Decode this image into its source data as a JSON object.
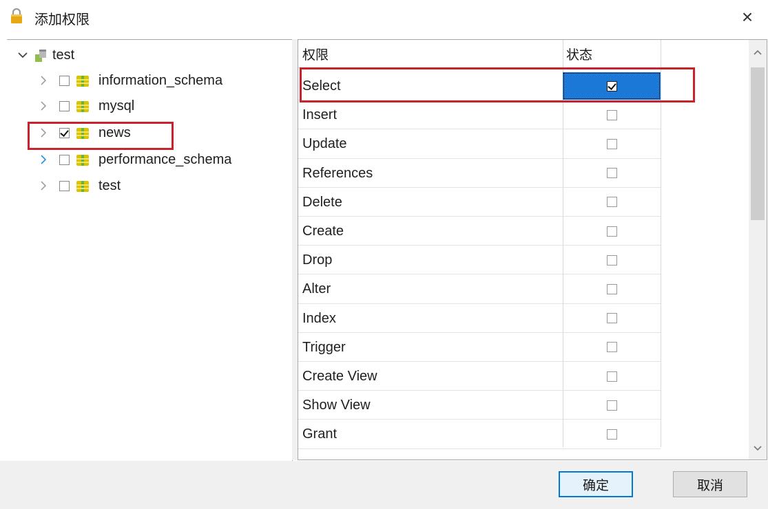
{
  "window": {
    "title": "添加权限",
    "close_glyph": "×"
  },
  "tree": {
    "root": {
      "label": "test",
      "icon": "user-icon",
      "expanded": true
    },
    "items": [
      {
        "label": "information_schema",
        "checked": false,
        "icon": "database-icon"
      },
      {
        "label": "mysql",
        "checked": false,
        "icon": "database-icon"
      },
      {
        "label": "news",
        "checked": true,
        "icon": "database-icon"
      },
      {
        "label": "performance_schema",
        "checked": false,
        "icon": "database-icon"
      },
      {
        "label": "test",
        "checked": false,
        "icon": "database-icon"
      }
    ],
    "chevron_glyph": "›",
    "root_chevron_glyph": "⌄"
  },
  "grid": {
    "headers": {
      "privilege": "权限",
      "state": "状态"
    },
    "rows": [
      {
        "name": "Select",
        "checked": true,
        "selected": true
      },
      {
        "name": "Insert",
        "checked": false
      },
      {
        "name": "Update",
        "checked": false
      },
      {
        "name": "References",
        "checked": false
      },
      {
        "name": "Delete",
        "checked": false
      },
      {
        "name": "Create",
        "checked": false
      },
      {
        "name": "Drop",
        "checked": false
      },
      {
        "name": "Alter",
        "checked": false
      },
      {
        "name": "Index",
        "checked": false
      },
      {
        "name": "Trigger",
        "checked": false
      },
      {
        "name": "Create View",
        "checked": false
      },
      {
        "name": "Show View",
        "checked": false
      },
      {
        "name": "Grant",
        "checked": false
      }
    ]
  },
  "scrollbar": {
    "up_glyph": "⌃",
    "down_glyph": "⌄"
  },
  "buttons": {
    "ok": "确定",
    "cancel": "取消"
  },
  "colors": {
    "highlight_red": "#c8232c",
    "selection_blue": "#1c78d7",
    "db_icon_yellow": "#d9c400",
    "db_icon_green": "#6cb33e",
    "lock_gold": "#e6a817",
    "primary_button_border": "#0078d7"
  }
}
